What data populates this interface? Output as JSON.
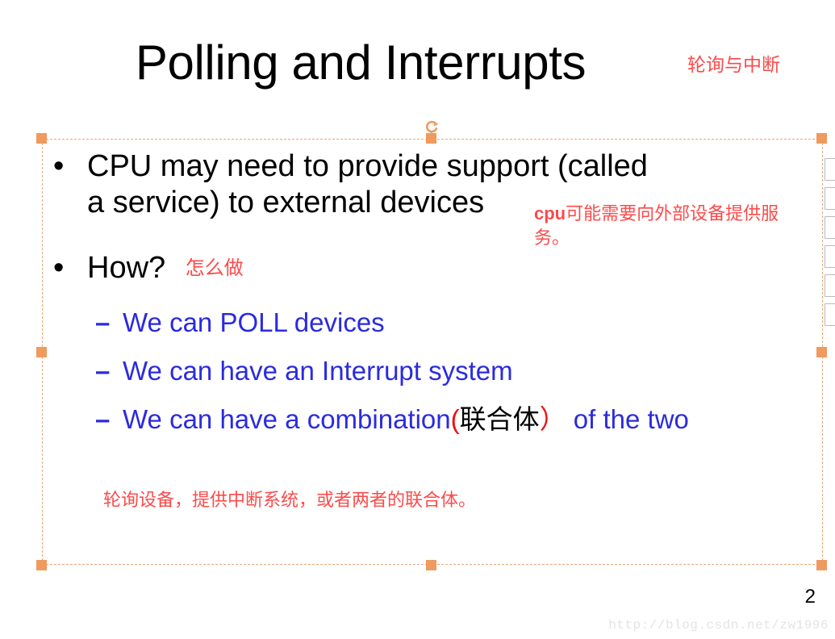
{
  "slide": {
    "title": "Polling and Interrupts",
    "title_note_cn": "轮询与中断",
    "page_number": "2",
    "watermark": "http://blog.csdn.net/zw1996"
  },
  "body": {
    "bullet_mark": "•",
    "dash_mark": "–",
    "bullets": [
      {
        "level": 1,
        "text": "CPU may need to provide support (called a service) to external devices"
      },
      {
        "level": 1,
        "text": "How?",
        "note_cn": "怎么做"
      }
    ],
    "sub_bullets": [
      {
        "level": 2,
        "text": "We can POLL devices"
      },
      {
        "level": 2,
        "text": "We can have an Interrupt system"
      },
      {
        "level": 2,
        "text_before": "We can have a combination",
        "paren_open": "(",
        "paren_cn": "联合体",
        "paren_close": "）",
        "text_after": "  of the two"
      }
    ],
    "note_bullet1": {
      "en": "cpu",
      "cn": "可能需要向外部设备提供服务。"
    },
    "note_bottom_cn": "轮询设备，提供中断系统，或者两者的联合体。"
  },
  "selection": {
    "placeholder_label": "content-placeholder",
    "handle_color": "#ef9a5e",
    "border_color": "#e8a87c",
    "rotate_icon": "rotate-icon"
  },
  "colors": {
    "title_text": "#000000",
    "body_text": "#000000",
    "sub_bullet_blue": "#2b2bdf",
    "annotation_red": "#fb4b4b",
    "paren_red": "#ee1111",
    "watermark_gray": "#e4e4e4"
  },
  "right_pane": {
    "item_count": 6,
    "label": "task-pane-clipped"
  }
}
